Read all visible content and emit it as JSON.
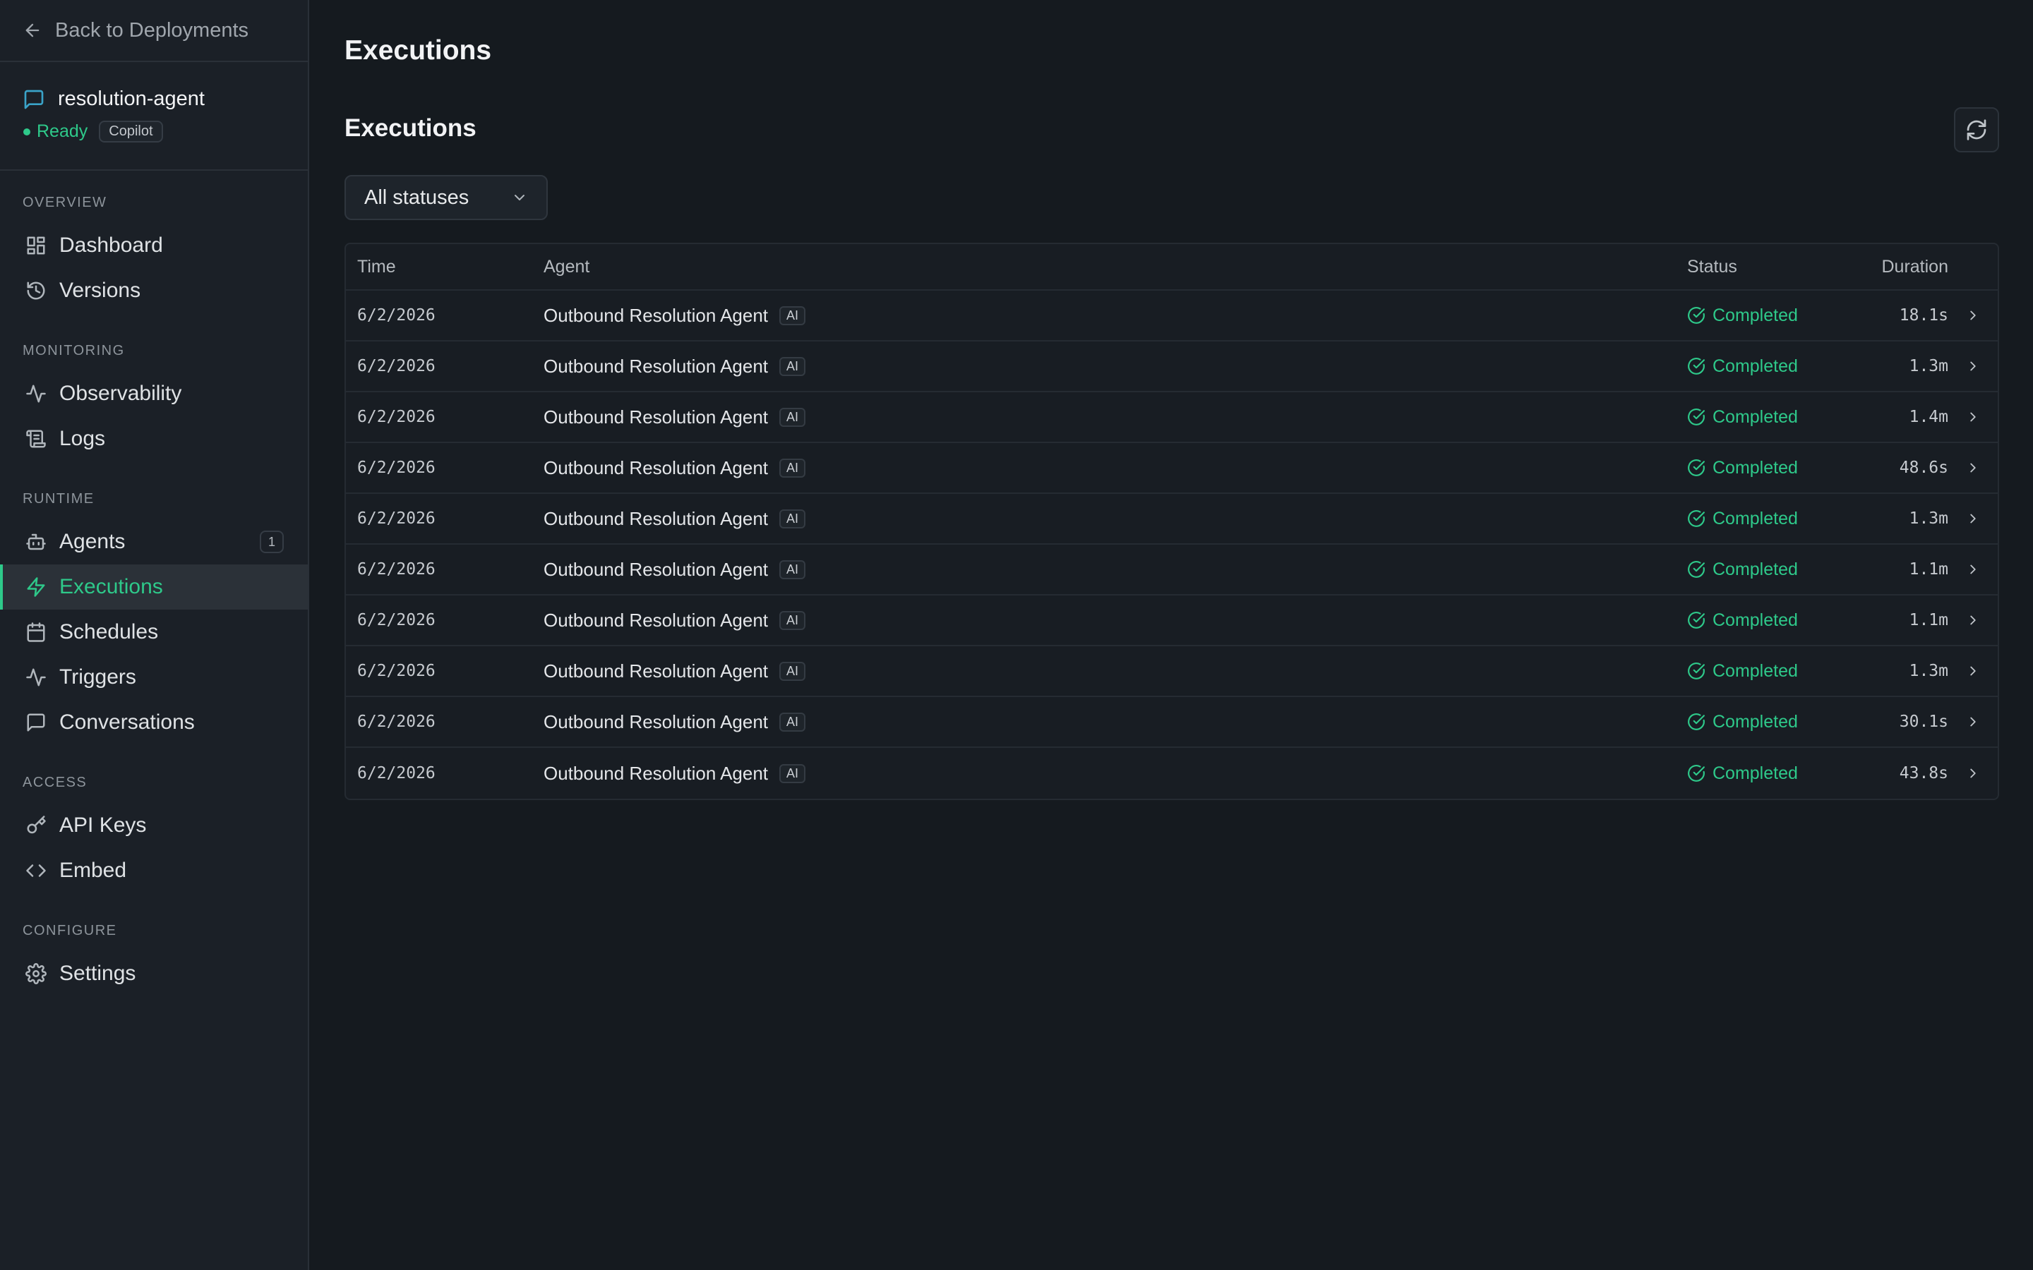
{
  "sidebar": {
    "back_label": "Back to Deployments",
    "project": {
      "name": "resolution-agent",
      "status": "Ready",
      "tag": "Copilot"
    },
    "sections": [
      {
        "title": "OVERVIEW",
        "items": [
          {
            "label": "Dashboard",
            "icon": "dashboard-icon"
          },
          {
            "label": "Versions",
            "icon": "history-icon"
          }
        ]
      },
      {
        "title": "MONITORING",
        "items": [
          {
            "label": "Observability",
            "icon": "activity-icon"
          },
          {
            "label": "Logs",
            "icon": "scroll-icon"
          }
        ]
      },
      {
        "title": "RUNTIME",
        "items": [
          {
            "label": "Agents",
            "icon": "bot-icon",
            "badge": "1"
          },
          {
            "label": "Executions",
            "icon": "lightning-icon",
            "active": true
          },
          {
            "label": "Schedules",
            "icon": "calendar-icon"
          },
          {
            "label": "Triggers",
            "icon": "activity-icon"
          },
          {
            "label": "Conversations",
            "icon": "message-icon"
          }
        ]
      },
      {
        "title": "ACCESS",
        "items": [
          {
            "label": "API Keys",
            "icon": "key-icon"
          },
          {
            "label": "Embed",
            "icon": "code-icon"
          }
        ]
      },
      {
        "title": "CONFIGURE",
        "items": [
          {
            "label": "Settings",
            "icon": "gear-icon"
          }
        ]
      }
    ]
  },
  "main": {
    "page_title": "Executions",
    "section_title": "Executions",
    "filter": {
      "selected": "All statuses"
    },
    "table": {
      "headers": {
        "time": "Time",
        "agent": "Agent",
        "status": "Status",
        "duration": "Duration"
      },
      "rows": [
        {
          "time": "6/2/2026",
          "agent": "Outbound Resolution Agent",
          "tag": "AI",
          "status": "Completed",
          "duration": "18.1s"
        },
        {
          "time": "6/2/2026",
          "agent": "Outbound Resolution Agent",
          "tag": "AI",
          "status": "Completed",
          "duration": "1.3m"
        },
        {
          "time": "6/2/2026",
          "agent": "Outbound Resolution Agent",
          "tag": "AI",
          "status": "Completed",
          "duration": "1.4m"
        },
        {
          "time": "6/2/2026",
          "agent": "Outbound Resolution Agent",
          "tag": "AI",
          "status": "Completed",
          "duration": "48.6s"
        },
        {
          "time": "6/2/2026",
          "agent": "Outbound Resolution Agent",
          "tag": "AI",
          "status": "Completed",
          "duration": "1.3m"
        },
        {
          "time": "6/2/2026",
          "agent": "Outbound Resolution Agent",
          "tag": "AI",
          "status": "Completed",
          "duration": "1.1m"
        },
        {
          "time": "6/2/2026",
          "agent": "Outbound Resolution Agent",
          "tag": "AI",
          "status": "Completed",
          "duration": "1.1m"
        },
        {
          "time": "6/2/2026",
          "agent": "Outbound Resolution Agent",
          "tag": "AI",
          "status": "Completed",
          "duration": "1.3m"
        },
        {
          "time": "6/2/2026",
          "agent": "Outbound Resolution Agent",
          "tag": "AI",
          "status": "Completed",
          "duration": "30.1s"
        },
        {
          "time": "6/2/2026",
          "agent": "Outbound Resolution Agent",
          "tag": "AI",
          "status": "Completed",
          "duration": "43.8s"
        }
      ]
    }
  },
  "colors": {
    "accent": "#2ec98a",
    "background": "#151a1f",
    "sidebar": "#1b2027",
    "project_icon": "#3aa3c8"
  }
}
